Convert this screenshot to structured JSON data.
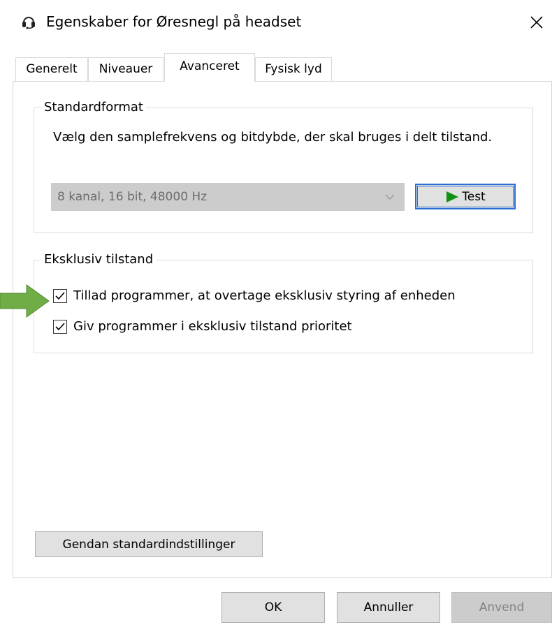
{
  "window": {
    "title": "Egenskaber for Øresnegl på headset",
    "icon": "headset-icon",
    "close_icon": "close-icon"
  },
  "tabs": [
    {
      "label": "Generelt",
      "active": false
    },
    {
      "label": "Niveauer",
      "active": false
    },
    {
      "label": "Avanceret",
      "active": true
    },
    {
      "label": "Fysisk lyd",
      "active": false
    }
  ],
  "standard_format": {
    "legend": "Standardformat",
    "description": "Vælg den samplefrekvens og bitdybde, der skal bruges i delt tilstand.",
    "selected_format": "8 kanal, 16 bit, 48000 Hz",
    "test_label": "Test",
    "test_icon": "play-icon"
  },
  "exclusive_mode": {
    "legend": "Eksklusiv tilstand",
    "options": [
      {
        "label": "Tillad programmer, at overtage eksklusiv styring af enheden",
        "checked": true
      },
      {
        "label": "Giv programmer i eksklusiv tilstand prioritet",
        "checked": true
      }
    ]
  },
  "restore_defaults_label": "Gendan standardindstillinger",
  "footer": {
    "ok_label": "OK",
    "cancel_label": "Annuller",
    "apply_label": "Anvend"
  },
  "annotation": {
    "arrow_color": "#70ad47",
    "arrow_icon": "right-arrow-icon"
  },
  "colors": {
    "accent": "#2a6fd1",
    "play_green": "#109110"
  }
}
